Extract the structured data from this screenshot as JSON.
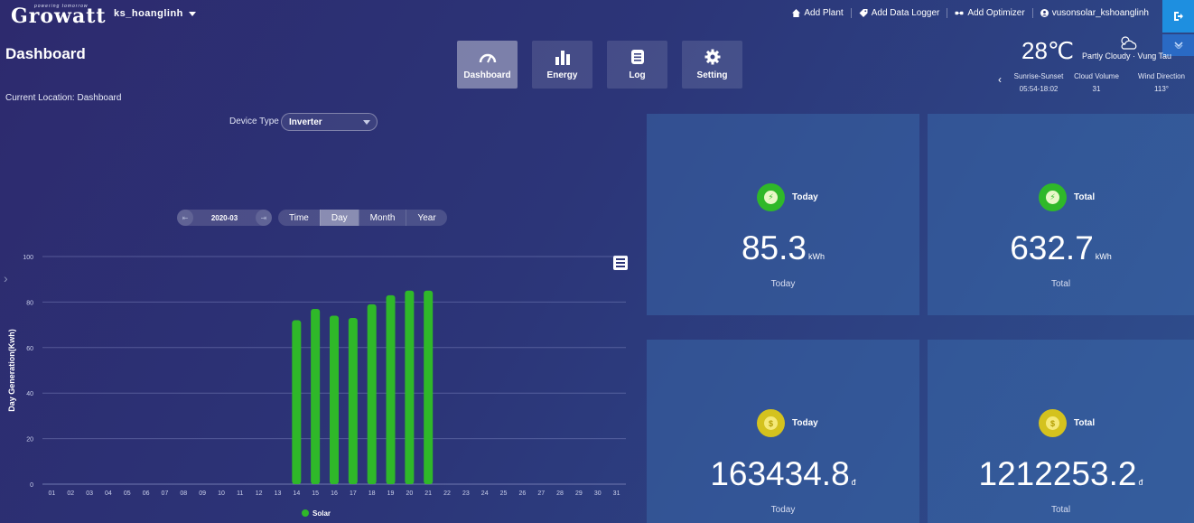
{
  "header": {
    "logo": "Growatt",
    "logo_tagline": "powering tomorrow",
    "user": "ks_hoanglinh",
    "links": [
      {
        "label": "Add Plant",
        "icon": "home-icon"
      },
      {
        "label": "Add Data Logger",
        "icon": "tag-icon"
      },
      {
        "label": "Add Optimizer",
        "icon": "link-icon"
      },
      {
        "label": "vusonsolar_kshoanglinh",
        "icon": "user-icon"
      }
    ]
  },
  "page": {
    "title": "Dashboard",
    "breadcrumb": "Current Location: Dashboard"
  },
  "nav": [
    {
      "label": "Dashboard",
      "icon": "gauge-icon",
      "active": true
    },
    {
      "label": "Energy",
      "icon": "bar-chart-icon",
      "active": false
    },
    {
      "label": "Log",
      "icon": "log-icon",
      "active": false
    },
    {
      "label": "Setting",
      "icon": "gear-icon",
      "active": false
    }
  ],
  "weather": {
    "temperature": "28℃",
    "condition": "Partly Cloudy · Vung Tau",
    "sunrise_label": "Sunrise-Sunset",
    "sunrise_value": "05:54-18:02",
    "cloud_label": "Cloud Volume",
    "cloud_value": "31",
    "wind_label": "Wind Direction",
    "wind_value": "113°"
  },
  "controls": {
    "device_type_label": "Device Type",
    "device_type_value": "Inverter",
    "date": "2020-03",
    "date_prev": "⇤",
    "date_next": "⇥",
    "ranges": [
      "Time",
      "Day",
      "Month",
      "Year"
    ],
    "active_range": "Day"
  },
  "stats": {
    "energy_today": {
      "label": "Today",
      "value": "85.3",
      "unit": "kWh",
      "sub": "Today"
    },
    "energy_total": {
      "label": "Total",
      "value": "632.7",
      "unit": "kWh",
      "sub": "Total"
    },
    "money_today": {
      "label": "Today",
      "value": "163434.8",
      "unit": "đ",
      "sub": "Today"
    },
    "money_total": {
      "label": "Total",
      "value": "1212253.2",
      "unit": "đ",
      "sub": "Total"
    }
  },
  "colors": {
    "bar": "#2fb829",
    "accent_blue": "#1e8fe0"
  },
  "chart_data": {
    "type": "bar",
    "categories": [
      "01",
      "02",
      "03",
      "04",
      "05",
      "06",
      "07",
      "08",
      "09",
      "10",
      "11",
      "12",
      "13",
      "14",
      "15",
      "16",
      "17",
      "18",
      "19",
      "20",
      "21",
      "22",
      "23",
      "24",
      "25",
      "26",
      "27",
      "28",
      "29",
      "30",
      "31"
    ],
    "series": [
      {
        "name": "Solar",
        "values": [
          0,
          0,
          0,
          0,
          0,
          0,
          0,
          0,
          0,
          0,
          0,
          0,
          0,
          72,
          77,
          74,
          73,
          79,
          83,
          85,
          85,
          0,
          0,
          0,
          0,
          0,
          0,
          0,
          0,
          0,
          0
        ]
      }
    ],
    "ylabel": "Day Generation(Kwh)",
    "xlabel": "",
    "ylim": [
      0,
      100
    ],
    "yticks": [
      0,
      20,
      40,
      60,
      80,
      100
    ],
    "grid": true,
    "legend": "bottom"
  }
}
